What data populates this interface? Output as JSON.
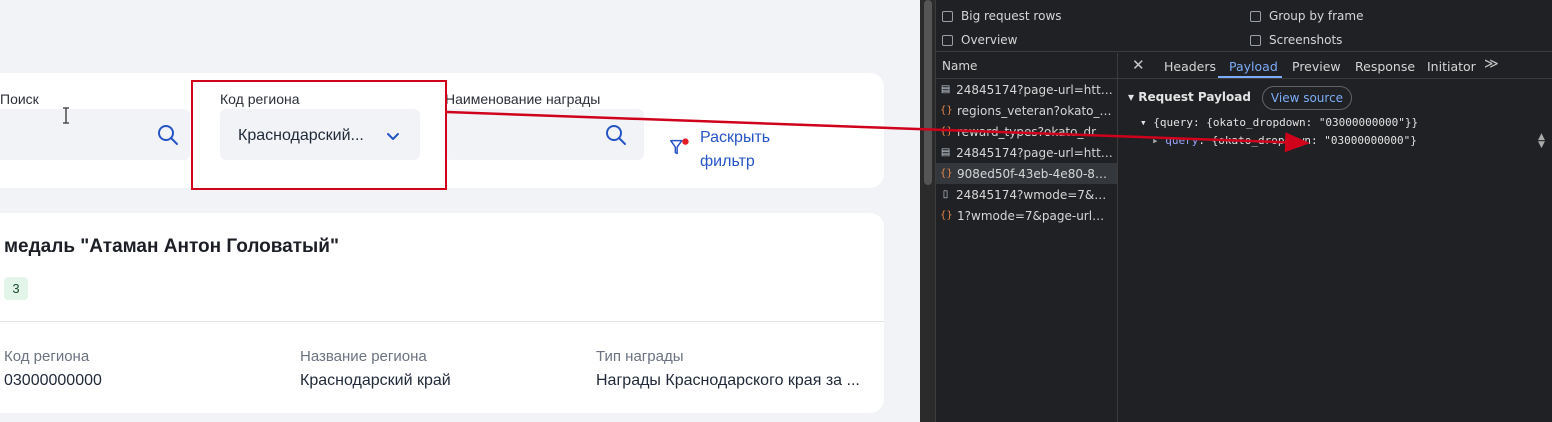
{
  "filters": {
    "search_label": "Поиск",
    "region_code_label": "Код региона",
    "region_code_value": "Краснодарский...",
    "award_name_label": "Наименование награды",
    "expand_filter": "Раскрыть фильтр"
  },
  "award": {
    "title": "медаль \"Атаман Антон Головатый\"",
    "badge": "3",
    "columns": [
      {
        "label": "Код региона",
        "value": "03000000000"
      },
      {
        "label": "Название региона",
        "value": "Краснодарский край"
      },
      {
        "label": "Тип награды",
        "value": "Награды Краснодарского края за ..."
      }
    ]
  },
  "devtools": {
    "options": {
      "big_request_rows": "Big request rows",
      "group_by_frame": "Group by frame",
      "overview": "Overview",
      "screenshots": "Screenshots"
    },
    "names_header": "Name",
    "requests": [
      {
        "type": "doc",
        "name": "24845174?page-url=https..."
      },
      {
        "type": "xhr",
        "name": "regions_veteran?okato_dro..."
      },
      {
        "type": "xhr",
        "name": "reward_types?okato_dropd..."
      },
      {
        "type": "doc",
        "name": "24845174?page-url=https..."
      },
      {
        "type": "xhr",
        "name": "908ed50f-43eb-4e80-8a4e..."
      },
      {
        "type": "file",
        "name": "24845174?wmode=7&pag..."
      },
      {
        "type": "xhr",
        "name": "1?wmode=7&page-url=htt..."
      }
    ],
    "selected_request": 4,
    "tabs": [
      "Headers",
      "Payload",
      "Preview",
      "Response",
      "Initiator"
    ],
    "active_tab": "Payload",
    "payload": {
      "header": "Request Payload",
      "view_source": "View source",
      "line1": "{query: {okato_dropdown: \"03000000000\"}}",
      "line2_key": "query",
      "line2_value": "{okato_dropdown: \"03000000000\"}"
    }
  },
  "colors": {
    "accent_blue": "#2554c7",
    "highlight_red": "#d0021b",
    "devtools_bg": "#202124",
    "devtools_link": "#7cacf8"
  }
}
